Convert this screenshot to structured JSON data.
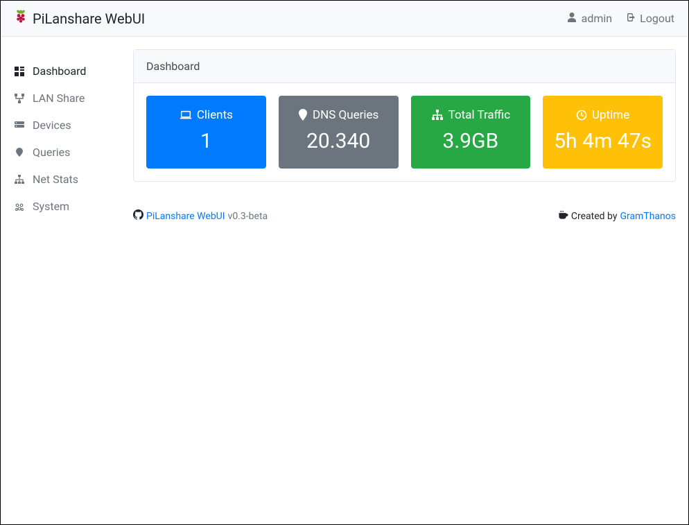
{
  "brand": "PiLanshare WebUI",
  "navbar": {
    "user": "admin",
    "logout": "Logout"
  },
  "sidebar": {
    "items": [
      {
        "label": "Dashboard"
      },
      {
        "label": "LAN Share"
      },
      {
        "label": "Devices"
      },
      {
        "label": "Queries"
      },
      {
        "label": "Net Stats"
      },
      {
        "label": "System"
      }
    ]
  },
  "page": {
    "title": "Dashboard"
  },
  "stats": {
    "clients": {
      "label": "Clients",
      "value": "1"
    },
    "dns": {
      "label": "DNS Queries",
      "value": "20.340"
    },
    "traffic": {
      "label": "Total Traffic",
      "value": "3.9GB"
    },
    "uptime": {
      "label": "Uptime",
      "value": "5h 4m 47s"
    }
  },
  "footer": {
    "repo_name": "PiLanshare WebUI",
    "version": "v0.3-beta",
    "created_by_prefix": "Created by ",
    "author": "GramThanos"
  }
}
